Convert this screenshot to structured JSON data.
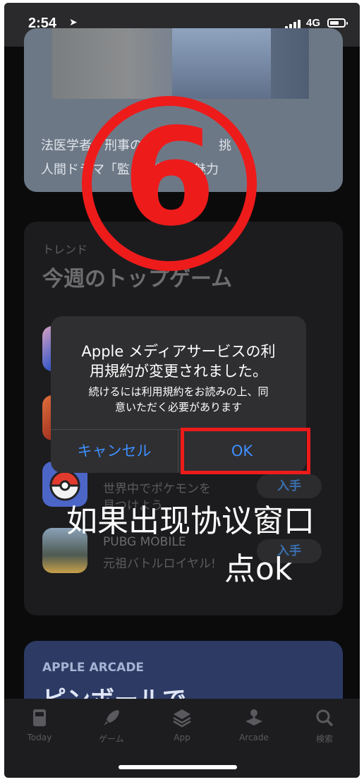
{
  "status_bar": {
    "time": "2:54",
    "location_arrow": "➤",
    "network": "4G"
  },
  "card_story": {
    "line1": "法医学者　刑事の　　　　　　挑",
    "line2": "人間ドラマ「監　朝顔」の魅力"
  },
  "card_games": {
    "eyebrow": "トレンド",
    "title": "今週のトップゲーム",
    "apps": [
      {
        "subtitle": "世界中でポケモンを",
        "subtitle2": "見つけよう",
        "get": "入手"
      },
      {
        "name": "PUBG MOBILE",
        "subtitle": "元祖バトルロイヤル!",
        "get": "入手"
      }
    ]
  },
  "card_arcade": {
    "eyebrow": "APPLE ARCADE",
    "title": "ピンボールで"
  },
  "dialog": {
    "title_line1": "Apple メディアサービスの利",
    "title_line2": "用規約が変更されました。",
    "msg_line1": "続けるには利用規約をお読みの上、同",
    "msg_line2": "意いただく必要があります",
    "cancel": "キャンセル",
    "ok": "OK"
  },
  "tabs": [
    {
      "label": "Today",
      "icon": "today-icon"
    },
    {
      "label": "ゲーム",
      "icon": "rocket-icon"
    },
    {
      "label": "App",
      "icon": "layers-icon"
    },
    {
      "label": "Arcade",
      "icon": "arcade-icon"
    },
    {
      "label": "検索",
      "icon": "search-icon"
    }
  ],
  "annotation": {
    "step": "6",
    "line1": "如果出现协议窗口",
    "line2": "点ok",
    "color": "#ee1b1b"
  }
}
